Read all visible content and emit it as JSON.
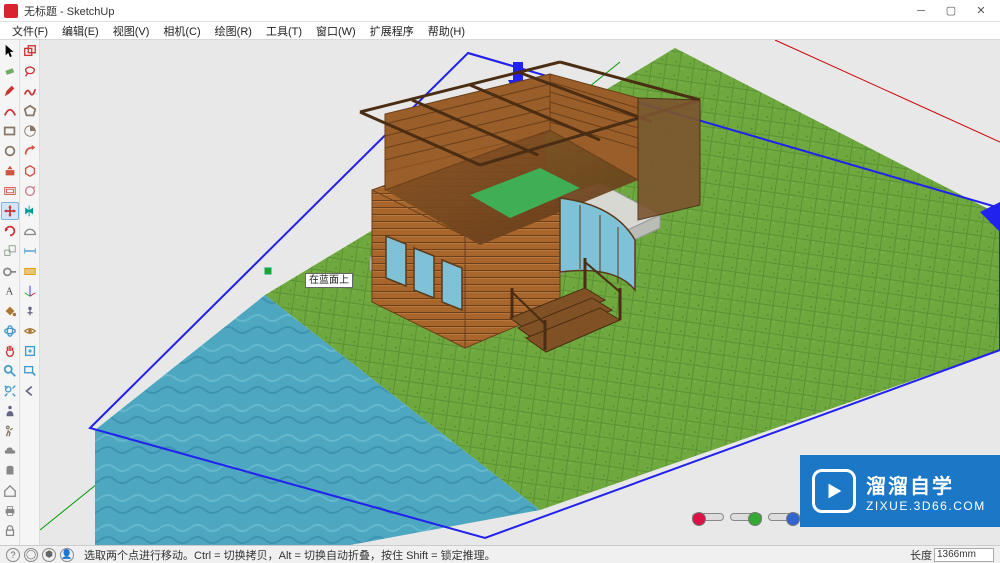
{
  "window": {
    "title": "无标题 - SketchUp"
  },
  "menu": {
    "items": [
      {
        "label": "文件(F)"
      },
      {
        "label": "编辑(E)"
      },
      {
        "label": "视图(V)"
      },
      {
        "label": "相机(C)"
      },
      {
        "label": "绘图(R)"
      },
      {
        "label": "工具(T)"
      },
      {
        "label": "窗口(W)"
      },
      {
        "label": "扩展程序"
      },
      {
        "label": "帮助(H)"
      }
    ]
  },
  "toolbarLeft": [
    {
      "name": "select-tool",
      "icon": "cursor",
      "color": "#000"
    },
    {
      "name": "eraser-tool",
      "icon": "eraser",
      "color": "#7a6"
    },
    {
      "name": "line-tool",
      "icon": "pencil",
      "color": "#c33"
    },
    {
      "name": "arc-tool",
      "icon": "arc",
      "color": "#c33"
    },
    {
      "name": "rectangle-tool",
      "icon": "rect",
      "color": "#876"
    },
    {
      "name": "circle-tool",
      "icon": "circle",
      "color": "#876"
    },
    {
      "name": "pushpull-tool",
      "icon": "pushpull",
      "color": "#c54"
    },
    {
      "name": "offset-tool",
      "icon": "offset",
      "color": "#c54"
    },
    {
      "name": "move-tool",
      "icon": "move",
      "color": "#c33",
      "selected": true
    },
    {
      "name": "rotate-tool",
      "icon": "rotate",
      "color": "#c33"
    },
    {
      "name": "scale-tool",
      "icon": "scale",
      "color": "#898"
    },
    {
      "name": "tape-tool",
      "icon": "tape",
      "color": "#888"
    },
    {
      "name": "text-tool",
      "icon": "text",
      "color": "#444"
    },
    {
      "name": "paint-tool",
      "icon": "bucket",
      "color": "#a73"
    },
    {
      "name": "orbit-tool",
      "icon": "orbit",
      "color": "#49c"
    },
    {
      "name": "pan-tool",
      "icon": "pan",
      "color": "#c33"
    },
    {
      "name": "zoom-tool",
      "icon": "zoom",
      "color": "#49c"
    },
    {
      "name": "zoom-extents-tool",
      "icon": "zoomext",
      "color": "#49c"
    },
    {
      "name": "component-tool",
      "icon": "person",
      "color": "#668"
    },
    {
      "name": "walk-tool",
      "icon": "walk",
      "color": "#876"
    },
    {
      "name": "warehouse-tool",
      "icon": "cloud",
      "color": "#888"
    },
    {
      "name": "paintcan-tool",
      "icon": "can",
      "color": "#888"
    },
    {
      "name": "house-tool",
      "icon": "house",
      "color": "#888"
    },
    {
      "name": "print-tool",
      "icon": "print",
      "color": "#888"
    },
    {
      "name": "unlock-tool",
      "icon": "lock",
      "color": "#888"
    }
  ],
  "toolbarRight": [
    {
      "name": "make-component",
      "icon": "comp",
      "color": "#c33"
    },
    {
      "name": "lasso-tool",
      "icon": "lasso",
      "color": "#c33"
    },
    {
      "name": "freehand-tool",
      "icon": "free",
      "color": "#c33"
    },
    {
      "name": "polygon-tool",
      "icon": "poly",
      "color": "#876"
    },
    {
      "name": "pie-tool",
      "icon": "pie",
      "color": "#876"
    },
    {
      "name": "followme-tool",
      "icon": "follow",
      "color": "#c54"
    },
    {
      "name": "outershell-tool",
      "icon": "shell",
      "color": "#c54"
    },
    {
      "name": "rotate2-tool",
      "icon": "rot2",
      "color": "#c78"
    },
    {
      "name": "flip-tool",
      "icon": "flip",
      "color": "#099"
    },
    {
      "name": "protractor-tool",
      "icon": "protr",
      "color": "#888"
    },
    {
      "name": "dim-tool",
      "icon": "dim",
      "color": "#49c"
    },
    {
      "name": "section-tool",
      "icon": "sect",
      "color": "#d90"
    },
    {
      "name": "axes-tool",
      "icon": "axes",
      "color": "#c33"
    },
    {
      "name": "position-camera-tool",
      "icon": "poscam",
      "color": "#668"
    },
    {
      "name": "looker-tool",
      "icon": "look",
      "color": "#a73"
    },
    {
      "name": "extensionwh-tool",
      "icon": "ext",
      "color": "#49c"
    },
    {
      "name": "zoomwin-tool",
      "icon": "zoomwin",
      "color": "#49c"
    },
    {
      "name": "prev-tool",
      "icon": "prev",
      "color": "#668"
    }
  ],
  "inference": {
    "label": "在蓝面上"
  },
  "status": {
    "hint": "选取两个点进行移动。Ctrl = 切换拷贝，Alt = 切换自动折叠，按住 Shift = 锁定推理。",
    "length_label": "长度",
    "length_value": "1366mm"
  },
  "watermark": {
    "brand": "溜溜自学",
    "url": "ZIXUE.3D66.COM"
  },
  "colors": {
    "skyGround": "#e8e8e8",
    "grass1": "#6fa83f",
    "grass2": "#5a9234",
    "water1": "#4ea7c1",
    "water2": "#3d94b0",
    "wood": "#a8662d",
    "woodDark": "#6b3f1a",
    "glass": "#7fc2d7",
    "brandBlue": "#1c78c7",
    "selectBlue": "#2222ee"
  }
}
